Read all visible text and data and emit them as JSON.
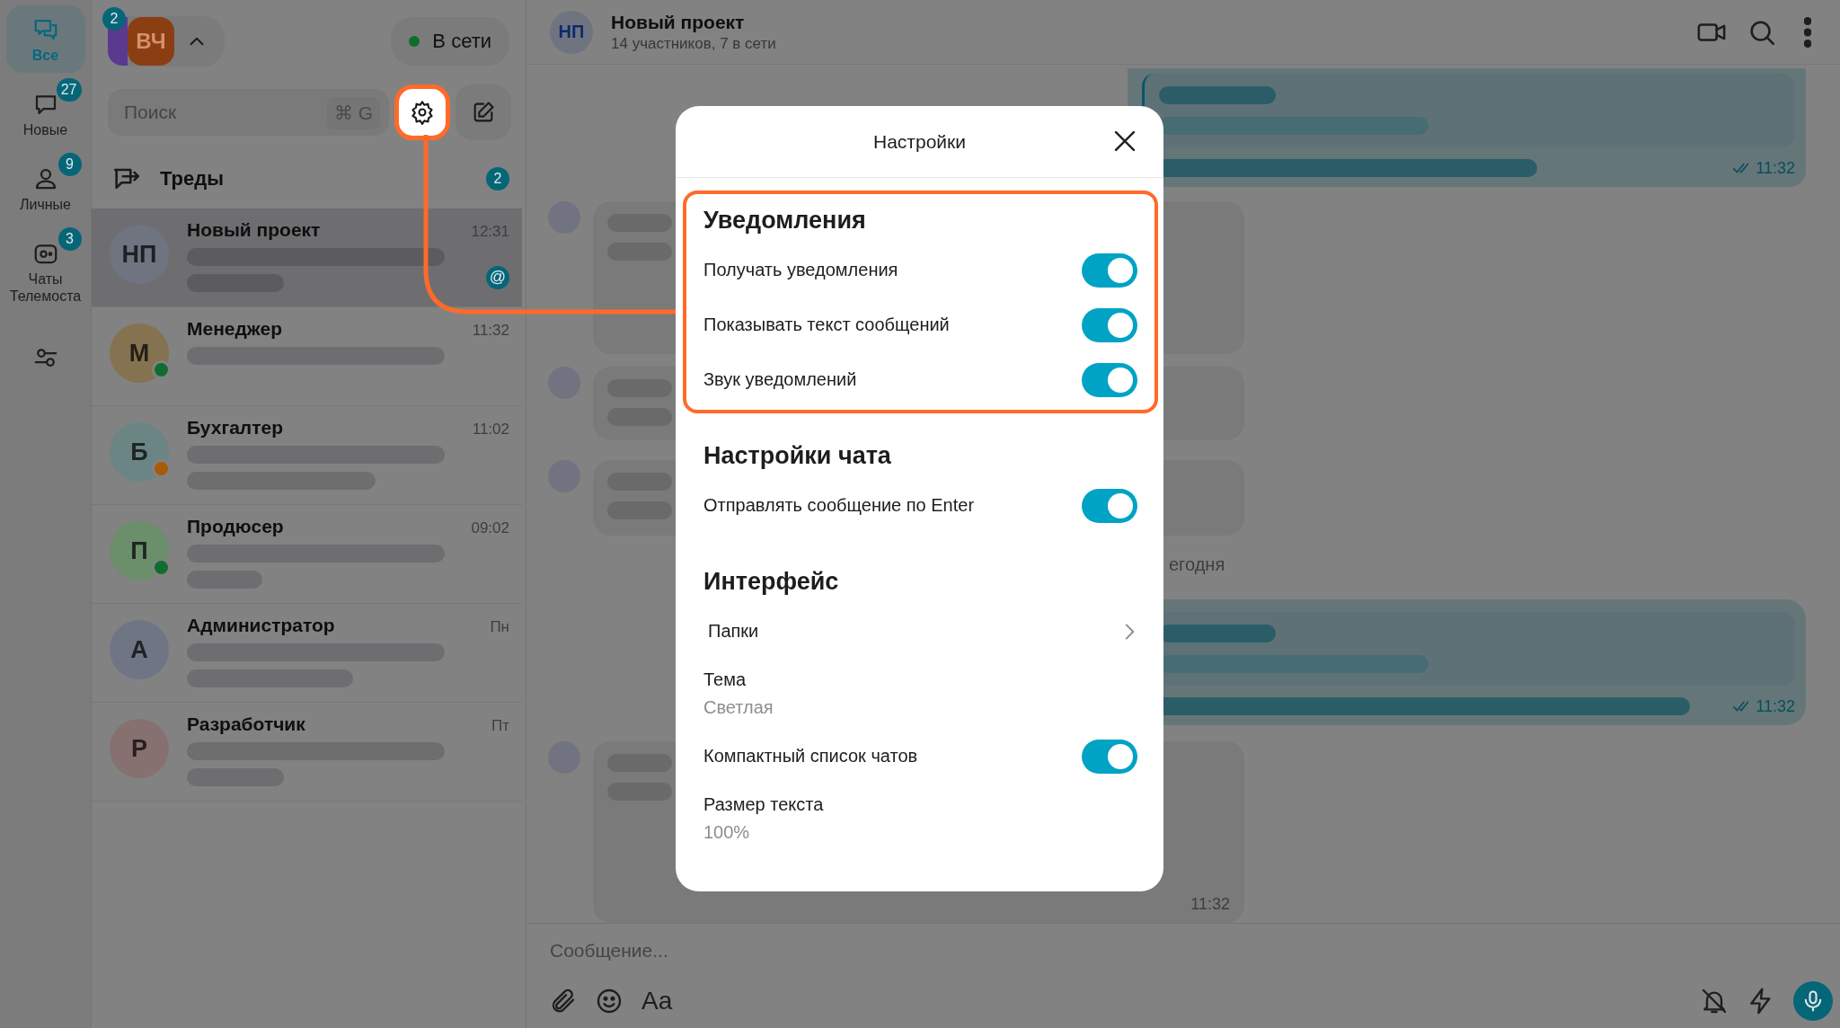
{
  "nav": [
    {
      "label": "Все",
      "selected": true
    },
    {
      "label": "Новые",
      "badge": "27",
      "selected": false
    },
    {
      "label": "Личные",
      "badge": "9",
      "selected": false
    },
    {
      "label": "Чаты Телемоста",
      "badge": "3",
      "selected": false
    }
  ],
  "accounts": {
    "badge": "2",
    "avatars": [
      {
        "color": "#5a3a8f"
      },
      {
        "initials": "ВЧ",
        "color": "#8a3e12"
      }
    ]
  },
  "status": {
    "label": "В сети",
    "online": true
  },
  "search": {
    "placeholder": "Поиск",
    "shortcut": "⌘ G",
    "settings_highlighted": true
  },
  "threads": {
    "label": "Треды",
    "count": "2"
  },
  "chats": [
    {
      "initials": "НП",
      "name": "Новый проект",
      "time": "12:31",
      "color": "#6f7480",
      "selected": true,
      "mention": "@"
    },
    {
      "initials": "М",
      "name": "Менеджер",
      "time": "11:32",
      "color": "#857250",
      "presence": {
        "color": "#0f6e2e"
      },
      "selected": false
    },
    {
      "initials": "Б",
      "name": "Бухгалтер",
      "time": "11:02",
      "color": "#6b8585",
      "presence": {
        "color": "#a85a08"
      },
      "selected": false
    },
    {
      "initials": "П",
      "name": "Продюсер",
      "time": "09:02",
      "color": "#6b8e6b",
      "presence": {
        "color": "#0f6e2e"
      },
      "selected": false
    },
    {
      "initials": "А",
      "name": "Администратор",
      "time": "Пн",
      "color": "#6f7585",
      "selected": false
    },
    {
      "initials": "Р",
      "name": "Разработчик",
      "time": "Пт",
      "color": "#877070",
      "selected": false
    }
  ],
  "conversation": {
    "initials": "НП",
    "title": "Новый проект",
    "subtitle": "14 участников, 7 в сети"
  },
  "messages": [
    {
      "kind": "outgoing",
      "time": "11:32",
      "read": true
    },
    {
      "kind": "incoming"
    },
    {
      "kind": "incoming"
    },
    {
      "kind": "incoming"
    },
    {
      "kind": "date",
      "label": "егодня"
    },
    {
      "kind": "outgoing",
      "time": "11:32",
      "read": true
    },
    {
      "kind": "incoming",
      "time": "11:32"
    }
  ],
  "composer": {
    "placeholder": "Сообщение...",
    "format_label": "Aa"
  },
  "settings": {
    "title": "Настройки",
    "sections": [
      {
        "title": "Уведомления",
        "highlighted": true,
        "items": [
          {
            "kind": "toggle",
            "label": "Получать уведомления",
            "on": true
          },
          {
            "kind": "toggle",
            "label": "Показывать текст сообщений",
            "on": true
          },
          {
            "kind": "toggle",
            "label": "Звук уведомлений",
            "on": true
          }
        ]
      },
      {
        "title": "Настройки чата",
        "highlighted": false,
        "items": [
          {
            "kind": "toggle",
            "label": "Отправлять сообщение по Enter",
            "on": true
          }
        ]
      },
      {
        "title": "Интерфейс",
        "highlighted": false,
        "items": [
          {
            "kind": "link",
            "label": "Папки"
          },
          {
            "kind": "value",
            "label": "Тема",
            "value": "Светлая"
          },
          {
            "kind": "toggle",
            "label": "Компактный список чатов",
            "on": true
          },
          {
            "kind": "value",
            "label": "Размер текста",
            "value": "100%"
          }
        ]
      }
    ]
  }
}
